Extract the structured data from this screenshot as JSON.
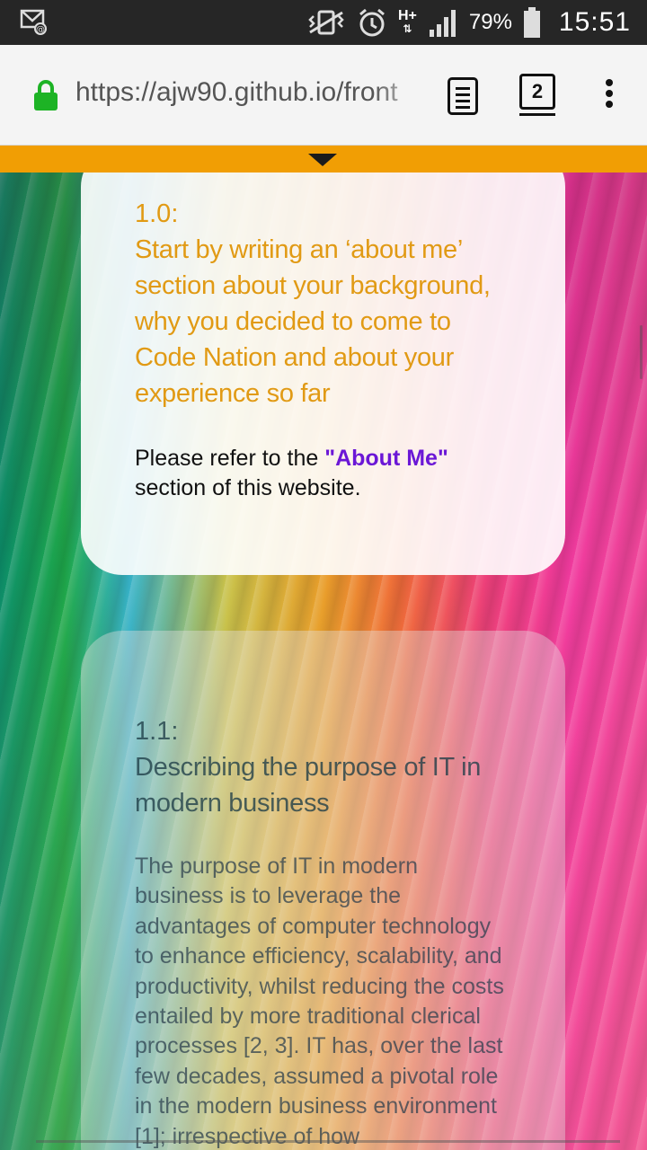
{
  "status_bar": {
    "battery_percent": "79%",
    "time": "15:51",
    "network": "H+",
    "icons": [
      "notification-email-icon",
      "vibrate-icon",
      "alarm-icon",
      "signal-icon",
      "battery-icon"
    ]
  },
  "browser": {
    "url": "https://ajw90.github.io/front",
    "tab_count": "2"
  },
  "cards": [
    {
      "number": "1.0:",
      "heading": "Start by writing an ‘about me’ section about your background, why you decided to come to Code Nation and about your experience so far",
      "body_prefix": "Please refer to the ",
      "link_text": "\"About Me\"",
      "body_suffix": " section of this website."
    },
    {
      "number": "1.1:",
      "heading": "Describing the purpose of IT in modern business",
      "body": "The purpose of IT in modern business is to leverage the advantages of computer technology to enhance efficiency, scalability, and productivity, whilst reducing the costs entailed by more traditional clerical processes [2, 3]. IT has, over the last few decades, assumed a pivotal role in the modern business environment [1]; irrespective of how"
    }
  ],
  "colors": {
    "status_bar": "#262626",
    "banner": "#f19e04",
    "heading_orange": "#e19a14",
    "link_purple": "#6b17d6",
    "lock_green": "#1db325"
  }
}
